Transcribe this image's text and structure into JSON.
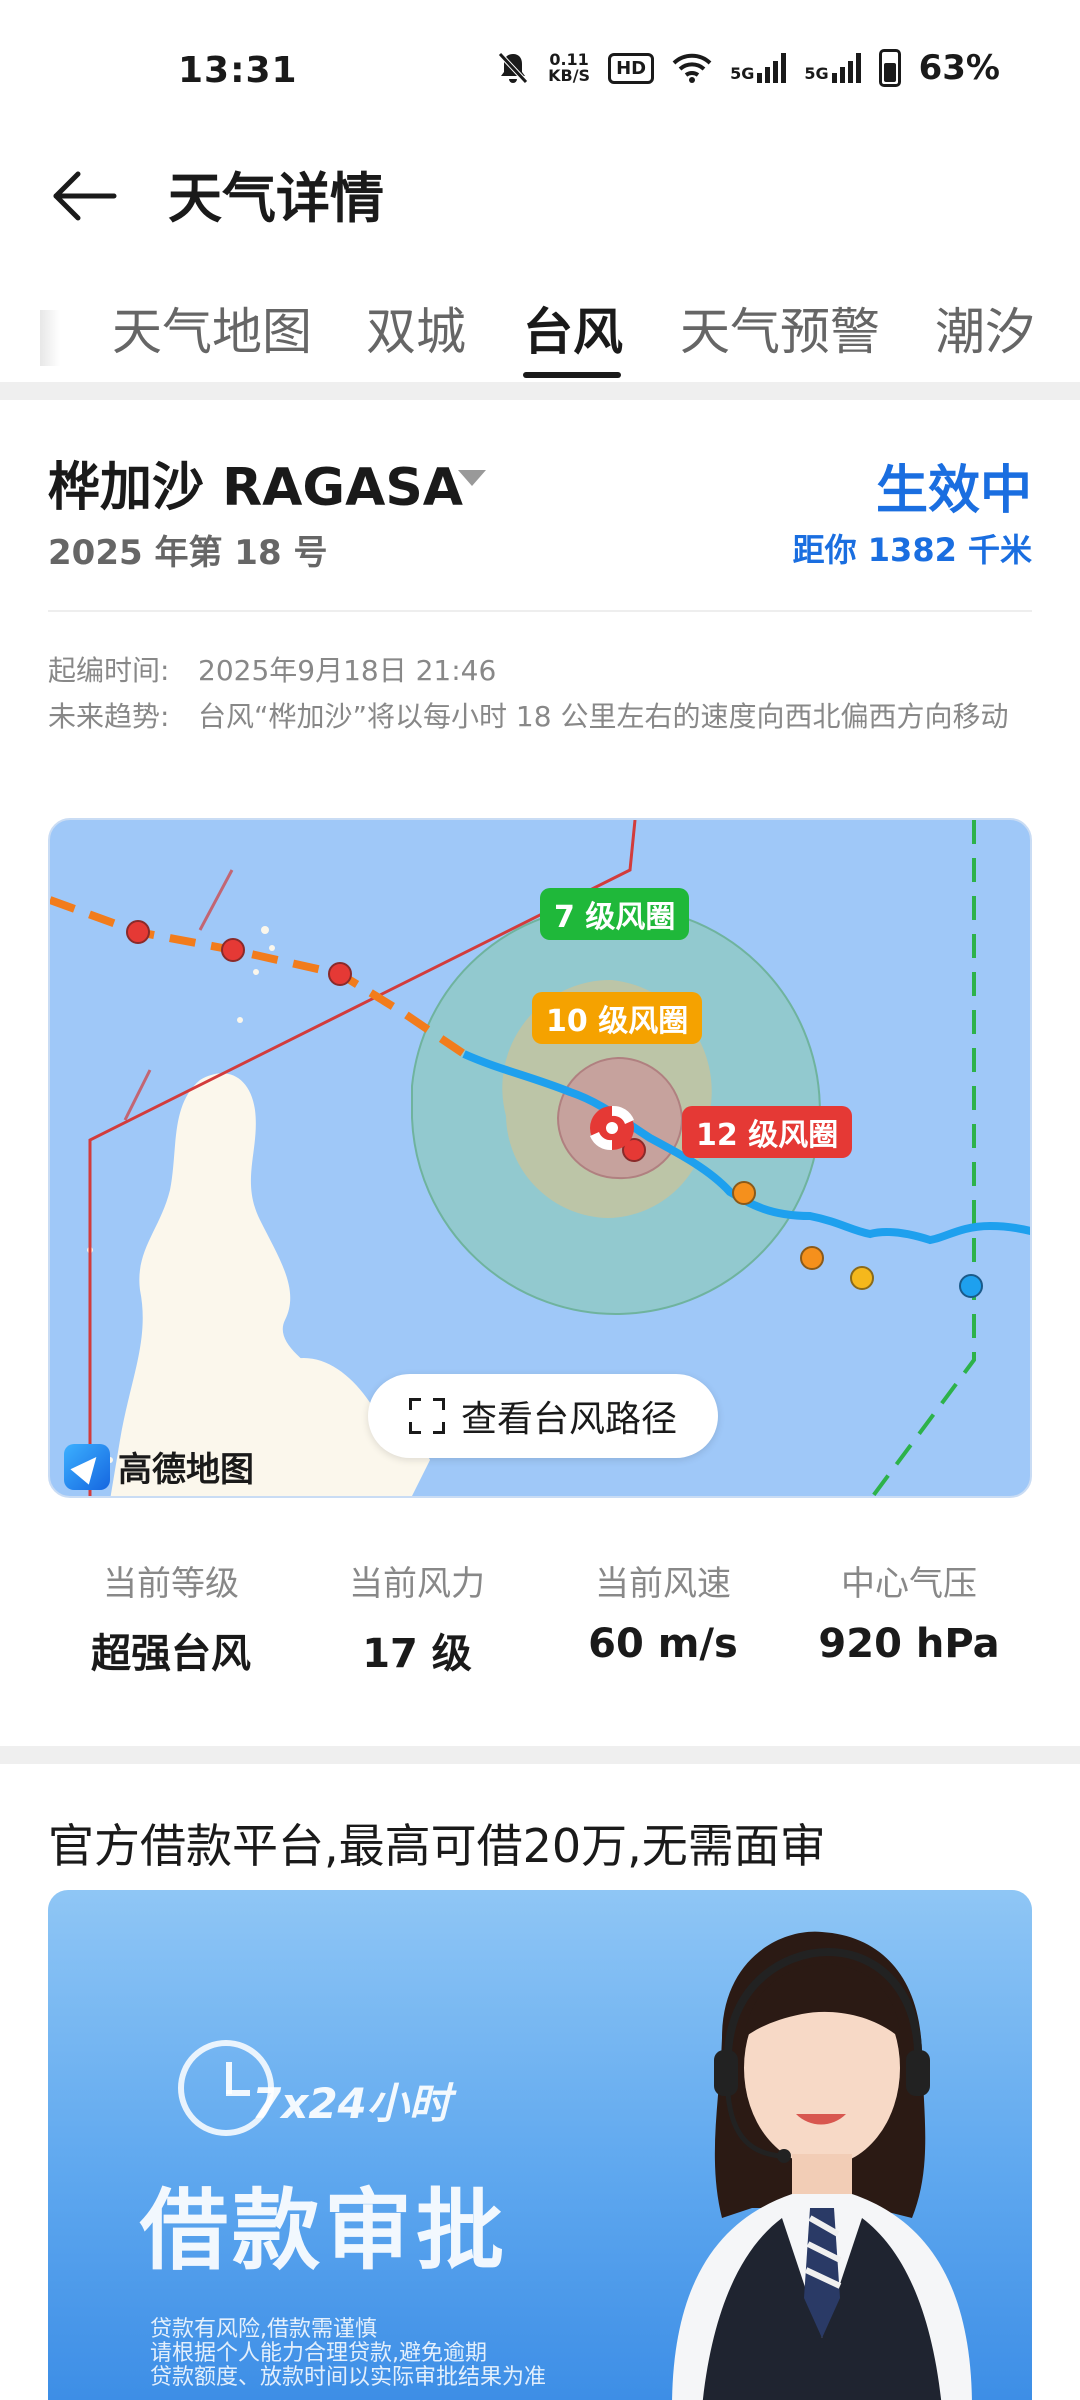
{
  "status_bar": {
    "time": "13:31",
    "net_speed_value": "0.11",
    "net_speed_unit": "KB/S",
    "hd_label": "HD",
    "signal_1": "5G",
    "signal_2": "5G",
    "battery": "63%",
    "icons": [
      "bell-muted-icon",
      "wifi-icon",
      "signal-icon",
      "battery-icon"
    ]
  },
  "header": {
    "title": "天气详情",
    "back_icon": "arrow-left-icon"
  },
  "tabs": [
    "天气地图",
    "双城",
    "台风",
    "天气预警",
    "潮汐"
  ],
  "active_tab": "台风",
  "typhoon": {
    "name": "桦加沙 RAGASA",
    "number": "2025 年第 18 号",
    "status": "生效中",
    "distance": "距你 1382 千米",
    "issued_label": "起编时间:",
    "issued_value": "2025年9月18日 21:46",
    "trend_label": "未来趋势:",
    "trend_value": "台风“桦加沙”将以每小时 18 公里左右的速度向西北偏西方向移动"
  },
  "map": {
    "circle_7": "7 级风圈",
    "circle_10": "10 级风圈",
    "circle_12": "12 级风圈",
    "route_button": "查看台风路径",
    "logo_text": "高德地图",
    "colors": {
      "sea": "#9fc8f8",
      "land": "#fbf7ec",
      "forecast": "#f27c1c",
      "track": "#1ea0ee",
      "circle7": "#8cc9b8",
      "warning_line": "#d23c3c",
      "alert_line": "#2db24a"
    }
  },
  "stats": [
    {
      "label": "当前等级",
      "value": "超强台风"
    },
    {
      "label": "当前风力",
      "value": "17 级"
    },
    {
      "label": "当前风速",
      "value": "60 m/s"
    },
    {
      "label": "中心气压",
      "value": "920 hPa"
    }
  ],
  "ad": {
    "title": "官方借款平台,最高可借20万,无需面审",
    "hours": "7x24小时",
    "headline": "借款审批",
    "fine_print_1": "贷款有风险,借款需谨慎",
    "fine_print_2": "请根据个人能力合理贷款,避免逾期",
    "fine_print_3": "贷款额度、放款时间以实际审批结果为准"
  }
}
